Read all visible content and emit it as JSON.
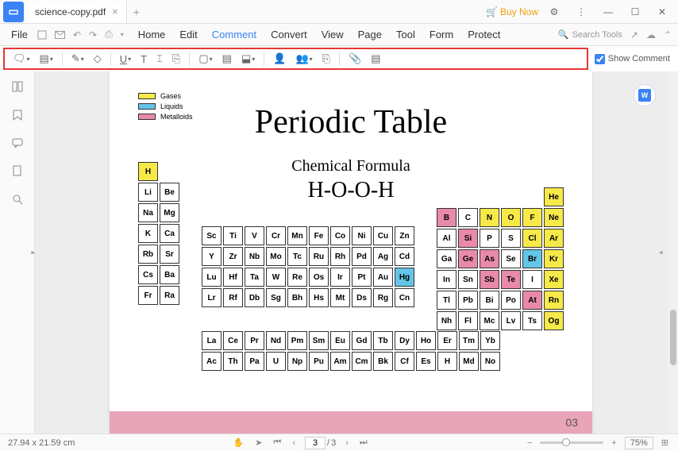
{
  "titlebar": {
    "filename": "science-copy.pdf",
    "buy_now": "Buy Now"
  },
  "menubar": {
    "file": "File",
    "tabs": [
      "Home",
      "Edit",
      "Comment",
      "Convert",
      "View",
      "Page",
      "Tool",
      "Form",
      "Protect"
    ],
    "active_index": 2,
    "search_placeholder": "Search Tools"
  },
  "toolbar": {
    "show_comment": "Show Comment"
  },
  "doc": {
    "title": "Periodic Table",
    "subtitle": "Chemical Formula",
    "formula": "H-O-O-H",
    "legend": [
      {
        "label": "Gases",
        "color": "#f7e948"
      },
      {
        "label": "Liquids",
        "color": "#63c5e8"
      },
      {
        "label": "Metalloids",
        "color": "#e88aa8"
      }
    ],
    "page_number": "03",
    "block1": [
      [
        [
          "H",
          "yellow"
        ]
      ],
      [
        [
          "Li",
          ""
        ],
        [
          "Be",
          ""
        ]
      ],
      [
        [
          "Na",
          ""
        ],
        [
          "Mg",
          ""
        ]
      ],
      [
        [
          "K",
          ""
        ],
        [
          "Ca",
          ""
        ]
      ],
      [
        [
          "Rb",
          ""
        ],
        [
          "Sr",
          ""
        ]
      ],
      [
        [
          "Cs",
          ""
        ],
        [
          "Ba",
          ""
        ]
      ],
      [
        [
          "Fr",
          ""
        ],
        [
          "Ra",
          ""
        ]
      ]
    ],
    "block2": [
      [
        [
          "Sc",
          ""
        ],
        [
          "Ti",
          ""
        ],
        [
          "V",
          ""
        ],
        [
          "Cr",
          ""
        ],
        [
          "Mn",
          ""
        ],
        [
          "Fe",
          ""
        ],
        [
          "Co",
          ""
        ],
        [
          "Ni",
          ""
        ],
        [
          "Cu",
          ""
        ],
        [
          "Zn",
          ""
        ]
      ],
      [
        [
          "Y",
          ""
        ],
        [
          "Zr",
          ""
        ],
        [
          "Nb",
          ""
        ],
        [
          "Mo",
          ""
        ],
        [
          "Tc",
          ""
        ],
        [
          "Ru",
          ""
        ],
        [
          "Rh",
          ""
        ],
        [
          "Pd",
          ""
        ],
        [
          "Ag",
          ""
        ],
        [
          "Cd",
          ""
        ]
      ],
      [
        [
          "Lu",
          ""
        ],
        [
          "Hf",
          ""
        ],
        [
          "Ta",
          ""
        ],
        [
          "W",
          ""
        ],
        [
          "Re",
          ""
        ],
        [
          "Os",
          ""
        ],
        [
          "Ir",
          ""
        ],
        [
          "Pt",
          ""
        ],
        [
          "Au",
          ""
        ],
        [
          "Hg",
          "blue"
        ]
      ],
      [
        [
          "Lr",
          ""
        ],
        [
          "Rf",
          ""
        ],
        [
          "Db",
          ""
        ],
        [
          "Sg",
          ""
        ],
        [
          "Bh",
          ""
        ],
        [
          "Hs",
          ""
        ],
        [
          "Mt",
          ""
        ],
        [
          "Ds",
          ""
        ],
        [
          "Rg",
          ""
        ],
        [
          "Cn",
          ""
        ]
      ]
    ],
    "block3": [
      [
        [
          "",
          "x"
        ],
        [
          "",
          "x"
        ],
        [
          "",
          "x"
        ],
        [
          "",
          "x"
        ],
        [
          "",
          "x"
        ],
        [
          "He",
          "yellow"
        ]
      ],
      [
        [
          "B",
          "pink"
        ],
        [
          "C",
          ""
        ],
        [
          "N",
          "yellow"
        ],
        [
          "O",
          "yellow"
        ],
        [
          "F",
          "yellow"
        ],
        [
          "Ne",
          "yellow"
        ]
      ],
      [
        [
          "Al",
          ""
        ],
        [
          "Si",
          "pink"
        ],
        [
          "P",
          ""
        ],
        [
          "S",
          ""
        ],
        [
          "Cl",
          "yellow"
        ],
        [
          "Ar",
          "yellow"
        ]
      ],
      [
        [
          "Ga",
          ""
        ],
        [
          "Ge",
          "pink"
        ],
        [
          "As",
          "pink"
        ],
        [
          "Se",
          ""
        ],
        [
          "Br",
          "blue"
        ],
        [
          "Kr",
          "yellow"
        ]
      ],
      [
        [
          "In",
          ""
        ],
        [
          "Sn",
          ""
        ],
        [
          "Sb",
          "pink"
        ],
        [
          "Te",
          "pink"
        ],
        [
          "I",
          ""
        ],
        [
          "Xe",
          "yellow"
        ]
      ],
      [
        [
          "Tl",
          ""
        ],
        [
          "Pb",
          ""
        ],
        [
          "Bi",
          ""
        ],
        [
          "Po",
          ""
        ],
        [
          "At",
          "pink"
        ],
        [
          "Rn",
          "yellow"
        ]
      ],
      [
        [
          "Nh",
          ""
        ],
        [
          "Fl",
          ""
        ],
        [
          "Mc",
          ""
        ],
        [
          "Lv",
          ""
        ],
        [
          "Ts",
          ""
        ],
        [
          "Og",
          "yellow"
        ]
      ]
    ],
    "block4": [
      [
        [
          "La",
          ""
        ],
        [
          "Ce",
          ""
        ],
        [
          "Pr",
          ""
        ],
        [
          "Nd",
          ""
        ],
        [
          "Pm",
          ""
        ],
        [
          "Sm",
          ""
        ],
        [
          "Eu",
          ""
        ],
        [
          "Gd",
          ""
        ],
        [
          "Tb",
          ""
        ],
        [
          "Dy",
          ""
        ],
        [
          "Ho",
          ""
        ],
        [
          "Er",
          ""
        ],
        [
          "Tm",
          ""
        ],
        [
          "Yb",
          ""
        ]
      ],
      [
        [
          "Ac",
          ""
        ],
        [
          "Th",
          ""
        ],
        [
          "Pa",
          ""
        ],
        [
          "U",
          ""
        ],
        [
          "Np",
          ""
        ],
        [
          "Pu",
          ""
        ],
        [
          "Am",
          ""
        ],
        [
          "Cm",
          ""
        ],
        [
          "Bk",
          ""
        ],
        [
          "Cf",
          ""
        ],
        [
          "Es",
          ""
        ],
        [
          "H",
          ""
        ],
        [
          "Md",
          ""
        ],
        [
          "No",
          ""
        ]
      ]
    ]
  },
  "status": {
    "dims": "27.94 x 21.59 cm",
    "page_current": "3",
    "page_total": "3",
    "zoom": "75%"
  }
}
